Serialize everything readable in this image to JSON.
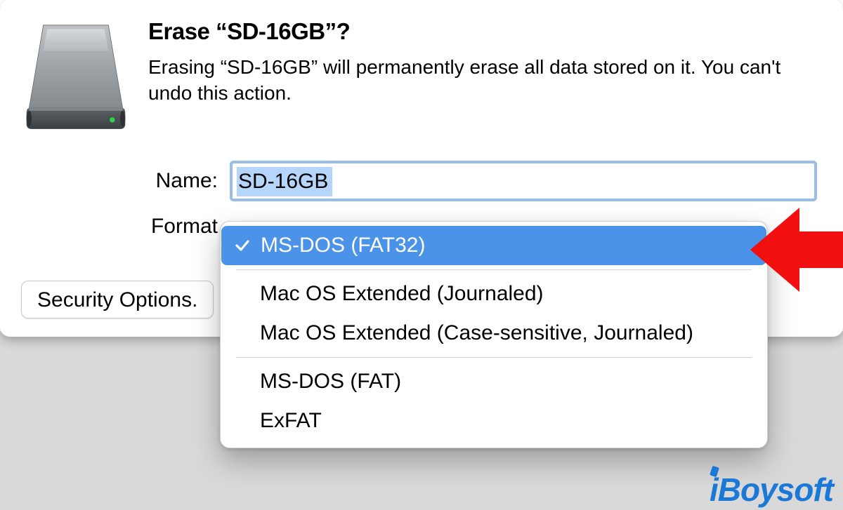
{
  "dialog": {
    "title": "Erase “SD-16GB”?",
    "description": "Erasing “SD-16GB” will permanently erase all data stored on it. You can't undo this action."
  },
  "form": {
    "name_label": "Name:",
    "name_value": "SD-16GB",
    "format_label": "Format"
  },
  "dropdown": {
    "selected": "MS-DOS (FAT32)",
    "groups": [
      {
        "items": [
          "MS-DOS (FAT32)"
        ],
        "selectedIndex": 0
      },
      {
        "items": [
          "Mac OS Extended (Journaled)",
          "Mac OS Extended (Case-sensitive, Journaled)"
        ]
      },
      {
        "items": [
          "MS-DOS (FAT)",
          "ExFAT"
        ]
      }
    ]
  },
  "buttons": {
    "security_options": "Security Options."
  },
  "branding": {
    "watermark": "iBoysoft"
  },
  "colors": {
    "selection_blue": "#4a93e8",
    "focus_ring": "#98bde8",
    "text_highlight": "#b6d5fb",
    "arrow_red": "#f20f0f"
  }
}
